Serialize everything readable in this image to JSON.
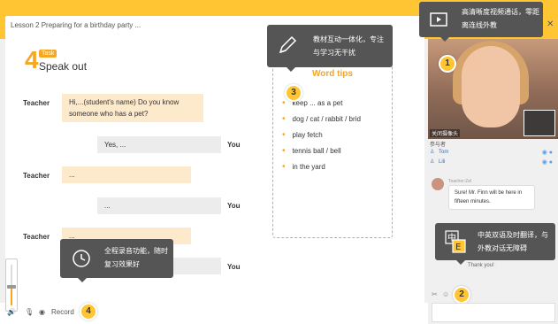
{
  "lesson": {
    "title": "Lesson 2  Preparing for a birthday party ..."
  },
  "task": {
    "number": "4",
    "tag": "Task",
    "title": "Speak out"
  },
  "dialogue": [
    {
      "role": "Teacher",
      "text": "Hi,...(student's name) Do you know someone who has a pet?"
    },
    {
      "role": "You",
      "text": "Yes, ..."
    },
    {
      "role": "Teacher",
      "text": "..."
    },
    {
      "role": "You",
      "text": "..."
    },
    {
      "role": "Teacher",
      "text": "..."
    },
    {
      "role": "You",
      "text": "..."
    }
  ],
  "word_tips": {
    "title": "Word tips",
    "items": [
      "keep ... as a pet",
      "dog / cat / rabbit / brid",
      "play fetch",
      "tennis ball / bell",
      "in the yard"
    ]
  },
  "tooltips": {
    "video": "高清晰度视频通话，零距离连线外教",
    "textbook": "教材互动一体化，专注与学习无干扰",
    "record": "全程录音功能，随时复习效果好",
    "translate": "中英双语及时翻译，与外教对话无障碍"
  },
  "markers": [
    "1",
    "2",
    "3",
    "4"
  ],
  "video": {
    "label": "关闭摄像头"
  },
  "participants": {
    "header": "参与者",
    "list": [
      "Tom",
      "Lili"
    ]
  },
  "chat": {
    "sender": "Teacher:Zel",
    "message": "Sure! Mr. Finn will be here in fifteen minutes.",
    "reply": "Thank you!"
  },
  "bottom": {
    "record_label": "Record"
  },
  "volume": 0.45,
  "colors": {
    "accent": "#ffc533",
    "orange": "#f5a623",
    "teacher_bubble": "#fde9cc",
    "student_bubble": "#ececec"
  }
}
